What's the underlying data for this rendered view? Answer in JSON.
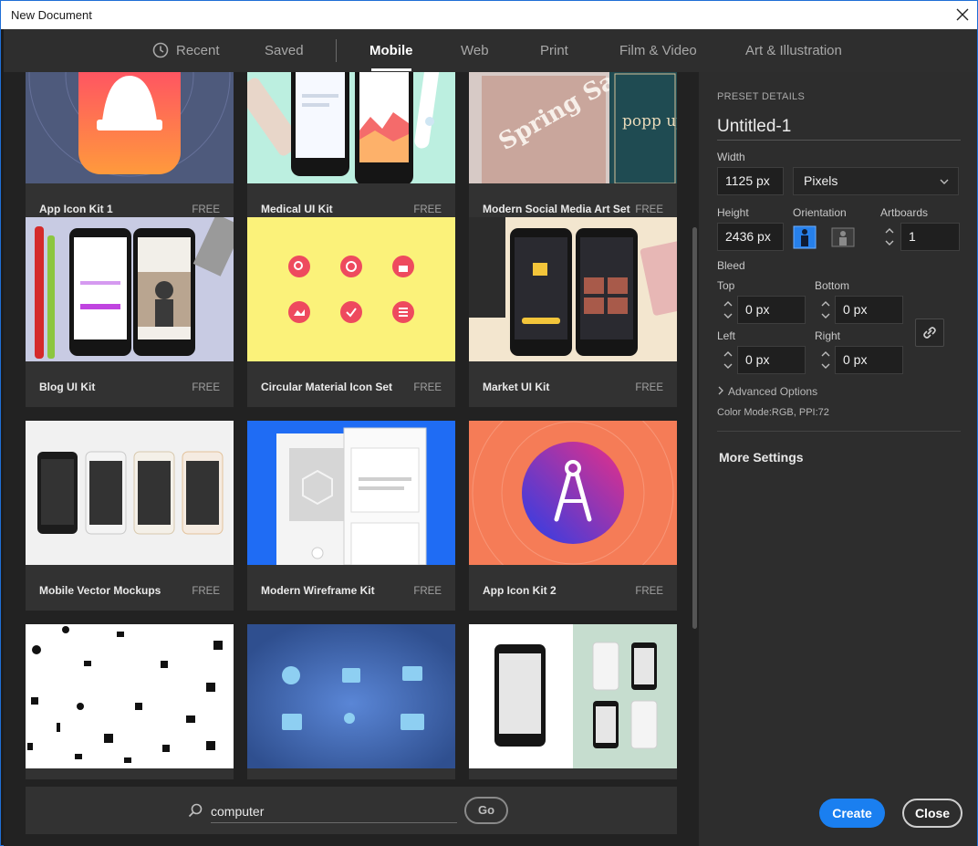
{
  "window": {
    "title": "New Document"
  },
  "tabs": [
    {
      "label": "Recent",
      "active": false
    },
    {
      "label": "Saved",
      "active": false
    },
    {
      "label": "Mobile",
      "active": true
    },
    {
      "label": "Web",
      "active": false
    },
    {
      "label": "Print",
      "active": false
    },
    {
      "label": "Film & Video",
      "active": false
    },
    {
      "label": "Art & Illustration",
      "active": false
    }
  ],
  "templates": [
    {
      "title": "App Icon Kit 1",
      "badge": "FREE"
    },
    {
      "title": "Medical UI Kit",
      "badge": "FREE"
    },
    {
      "title": "Modern Social Media Art Set",
      "badge": "FREE"
    },
    {
      "title": "Blog UI Kit",
      "badge": "FREE"
    },
    {
      "title": "Circular Material Icon Set",
      "badge": "FREE"
    },
    {
      "title": "Market UI Kit",
      "badge": "FREE"
    },
    {
      "title": "Mobile Vector Mockups",
      "badge": "FREE"
    },
    {
      "title": "Modern Wireframe Kit",
      "badge": "FREE"
    },
    {
      "title": "App Icon Kit 2",
      "badge": "FREE"
    }
  ],
  "thumbnail_text": {
    "spring_sale": "Spring Sale",
    "pop_up_brooklyn": "popp up brook"
  },
  "search": {
    "value": "computer",
    "go_label": "Go"
  },
  "preset": {
    "heading": "PRESET DETAILS",
    "name": "Untitled-1",
    "width_label": "Width",
    "width_value": "1125 px",
    "unit": "Pixels",
    "height_label": "Height",
    "height_value": "2436 px",
    "orientation_label": "Orientation",
    "orientation": "portrait",
    "artboards_label": "Artboards",
    "artboards_value": "1",
    "bleed_label": "Bleed",
    "top_label": "Top",
    "top_value": "0 px",
    "bottom_label": "Bottom",
    "bottom_value": "0 px",
    "left_label": "Left",
    "left_value": "0 px",
    "right_label": "Right",
    "right_value": "0 px",
    "advanced_label": "Advanced Options",
    "color_mode": "Color Mode:RGB, PPI:72",
    "more_settings": "More Settings"
  },
  "buttons": {
    "create": "Create",
    "close": "Close"
  },
  "colors": {
    "accent": "#1a7ff0",
    "panel": "#2d2d2d",
    "grid": "#222222"
  }
}
